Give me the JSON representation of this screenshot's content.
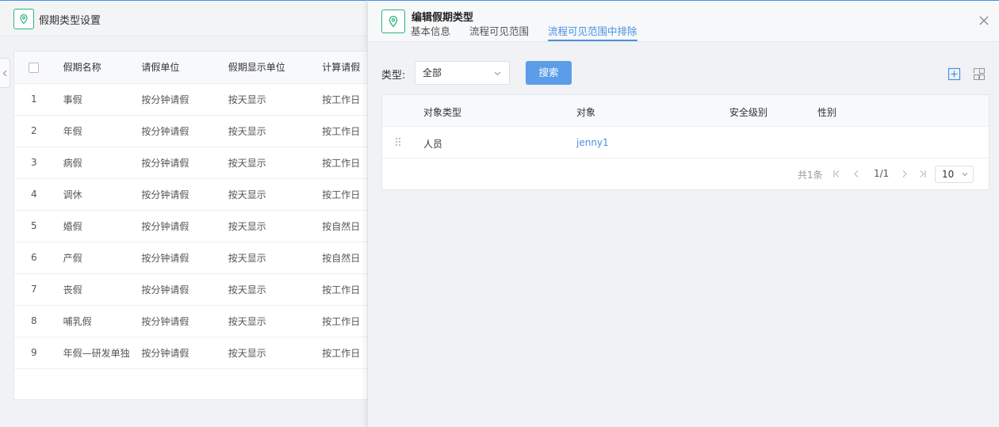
{
  "background": {
    "title": "假期类型设置",
    "table": {
      "headers": [
        "假期名称",
        "请假单位",
        "假期显示单位",
        "计算请假"
      ],
      "rows": [
        {
          "no": "1",
          "name": "事假",
          "unit": "按分钟请假",
          "display": "按天显示",
          "calc": "按工作日"
        },
        {
          "no": "2",
          "name": "年假",
          "unit": "按分钟请假",
          "display": "按天显示",
          "calc": "按工作日"
        },
        {
          "no": "3",
          "name": "病假",
          "unit": "按分钟请假",
          "display": "按天显示",
          "calc": "按工作日"
        },
        {
          "no": "4",
          "name": "调休",
          "unit": "按分钟请假",
          "display": "按天显示",
          "calc": "按工作日"
        },
        {
          "no": "5",
          "name": "婚假",
          "unit": "按分钟请假",
          "display": "按天显示",
          "calc": "按自然日"
        },
        {
          "no": "6",
          "name": "产假",
          "unit": "按分钟请假",
          "display": "按天显示",
          "calc": "按自然日"
        },
        {
          "no": "7",
          "name": "丧假",
          "unit": "按分钟请假",
          "display": "按天显示",
          "calc": "按工作日"
        },
        {
          "no": "8",
          "name": "哺乳假",
          "unit": "按分钟请假",
          "display": "按天显示",
          "calc": "按工作日"
        },
        {
          "no": "9",
          "name": "年假—研发单独",
          "unit": "按分钟请假",
          "display": "按天显示",
          "calc": "按工作日"
        }
      ]
    }
  },
  "drawer": {
    "title": "编辑假期类型",
    "tabs": [
      {
        "label": "基本信息",
        "active": false
      },
      {
        "label": "流程可见范围",
        "active": false
      },
      {
        "label": "流程可见范围中排除",
        "active": true
      }
    ],
    "filter": {
      "label": "类型:",
      "selected": "全部",
      "search_label": "搜索"
    },
    "grid": {
      "headers": [
        "对象类型",
        "对象",
        "安全级别",
        "性别"
      ],
      "rows": [
        {
          "type": "人员",
          "object": "jenny1",
          "security": "",
          "gender": ""
        }
      ]
    },
    "pager": {
      "total": "共1条",
      "page_info": "1/1",
      "page_size": "10"
    }
  },
  "colors": {
    "accent": "#4a90e2",
    "brand_green": "#2ab57a",
    "button": "#5b9de8"
  }
}
